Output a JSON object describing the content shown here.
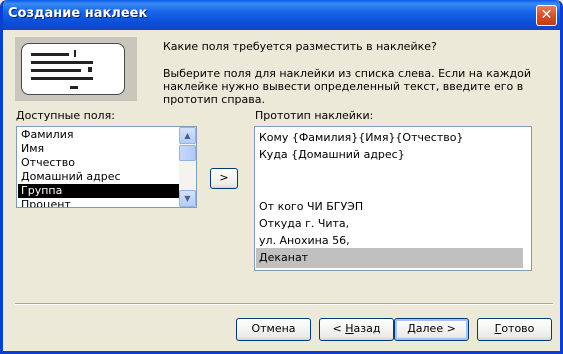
{
  "window": {
    "title": "Создание наклеек",
    "close_glyph": "✕"
  },
  "intro": {
    "question": "Какие поля требуется разместить в наклейке?",
    "instructions": "Выберите поля для наклейки из списка слева. Если на каждой наклейке нужно вывести определенный текст, введите его в прототип справа."
  },
  "available": {
    "label": "Доступные поля:",
    "items": [
      "Фамилия",
      "Имя",
      "Отчество",
      "Домашний адрес",
      "Группа",
      "Процент"
    ],
    "selected": "Группа"
  },
  "move_button": {
    "label": ">"
  },
  "prototype": {
    "label": "Прототип наклейки:",
    "lines": [
      "Кому {Фамилия}{Имя}{Отчество}",
      "Куда {Домашний адрес}",
      "",
      "",
      "От кого ЧИ БГУЭП",
      "Откуда г. Чита,",
      "ул. Анохина 56,",
      "Деканат"
    ],
    "selected_line": "Деканат"
  },
  "buttons": {
    "cancel": "Отмена",
    "back_prefix": "< ",
    "back_key": "Н",
    "back_rest": "азад",
    "next_key": "Д",
    "next_rest": "алее >",
    "finish_key": "Г",
    "finish_rest": "отово"
  }
}
